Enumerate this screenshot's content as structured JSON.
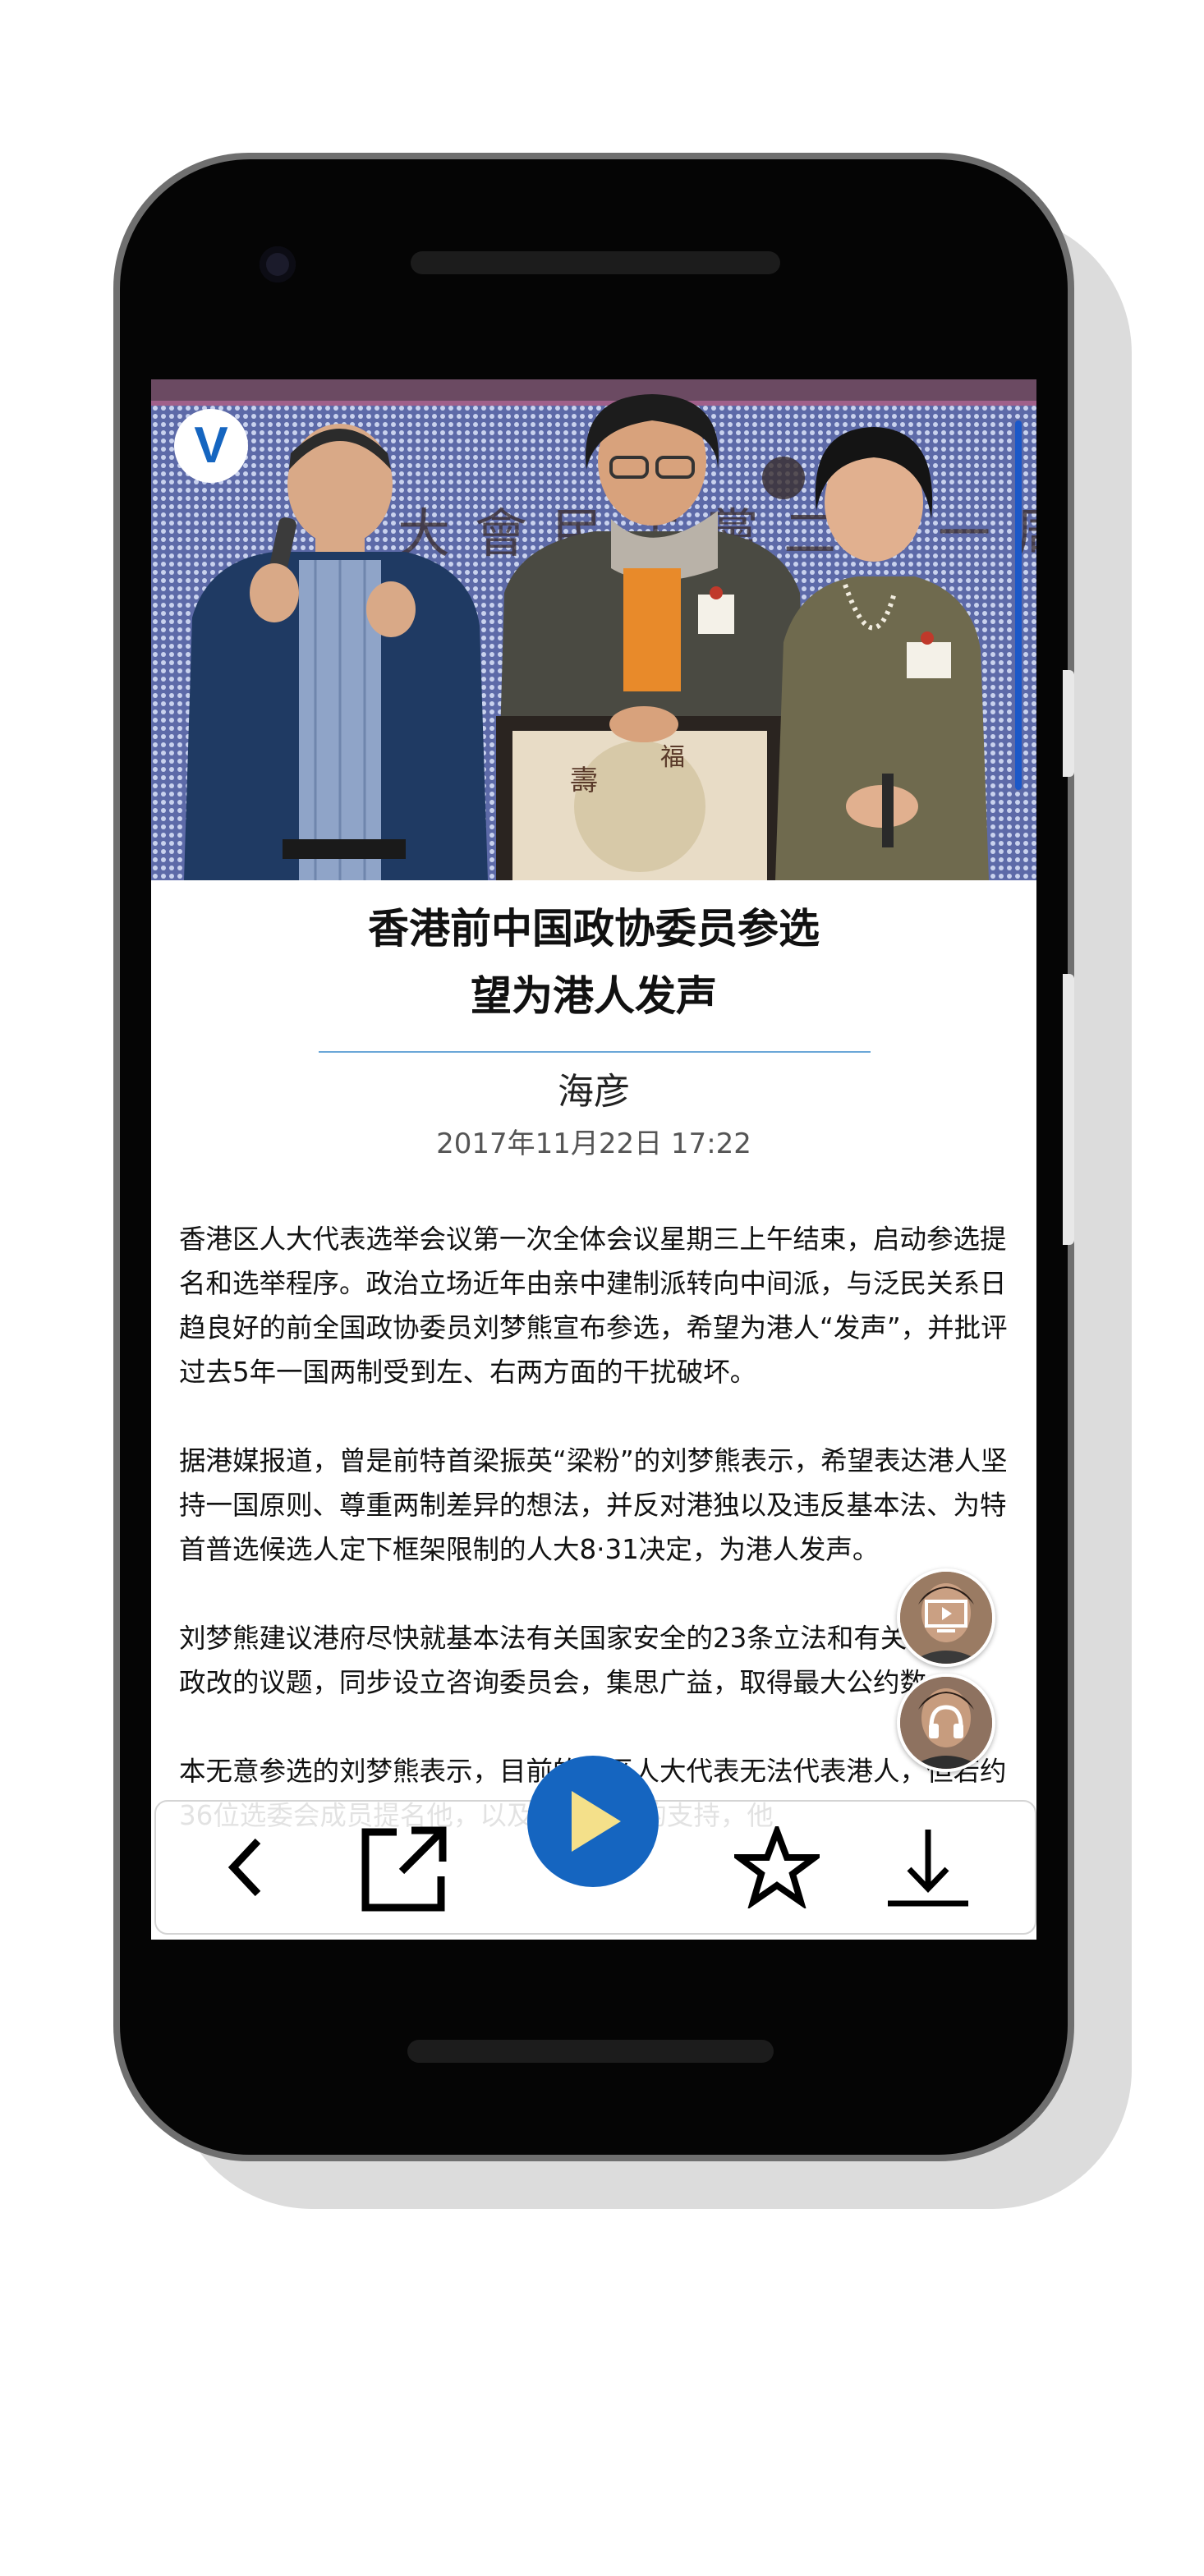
{
  "article": {
    "title_line1": "香港前中国政协委员参选",
    "title_line2": "望为港人发声",
    "author": "海彦",
    "date": "2017年11月22日 17:22",
    "paragraphs": [
      "香港区人大代表选举会议第一次全体会议星期三上午结束，启动参选提名和选举程序。政治立场近年由亲中建制派转向中间派，与泛民关系日趋良好的前全国政协委员刘梦熊宣布参选，希望为港人“发声”，并批评过去5年一国两制受到左、右两方面的干扰破坏。",
      "据港媒报道，曾是前特首梁振英“梁粉”的刘梦熊表示，希望表达港人坚持一国原则、尊重两制差异的想法，并反对港独以及违反基本法、为特首普选候选人定下框架限制的人大8·31决定，为港人发声。",
      "刘梦熊建议港府尽快就基本法有关国家安全的23条立法和有关普选的政改的议题，同步设立咨询委员会，集思广益，取得最大公约数。",
      "本无意参选的刘梦熊表示，目前的港区人大代表无法代表港人，但若约36位选委会成员提名他，以及许多市民的支持，他"
    ]
  },
  "hero": {
    "logo_letter": "V",
    "banner_text": "大會民主黨二十一周"
  },
  "floating": {
    "video_icon": "video-play-icon",
    "audio_icon": "headphones-icon"
  },
  "toolbar": {
    "back_icon": "chevron-left-icon",
    "share_icon": "share-external-icon",
    "play_icon": "play-icon",
    "favorite_icon": "star-outline-icon",
    "download_icon": "download-icon"
  },
  "colors": {
    "accent": "#1565c0",
    "play_triangle": "#f4e08a",
    "title_rule": "#6aa7d8",
    "phone_body": "#050505"
  }
}
